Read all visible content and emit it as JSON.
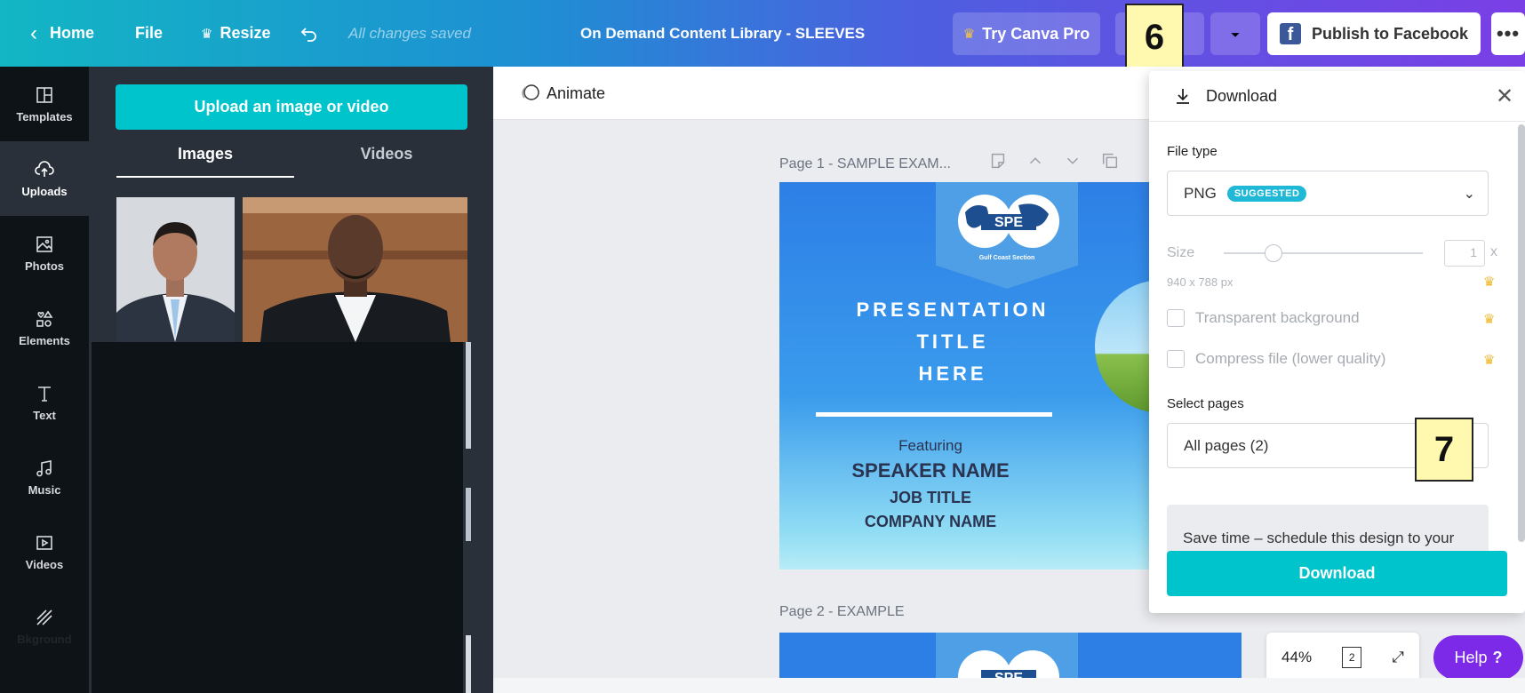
{
  "topbar": {
    "home": "Home",
    "file": "File",
    "resize": "Resize",
    "saved_status": "All changes saved",
    "doc_title": "On Demand Content Library - SLEEVES",
    "try_pro": "Try Canva Pro",
    "publish": "Publish to Facebook",
    "more": "•••"
  },
  "badges": {
    "six": "6",
    "seven": "7"
  },
  "rail": [
    {
      "label": "Templates",
      "icon": "templates-icon"
    },
    {
      "label": "Uploads",
      "icon": "uploads-icon"
    },
    {
      "label": "Photos",
      "icon": "photos-icon"
    },
    {
      "label": "Elements",
      "icon": "elements-icon"
    },
    {
      "label": "Text",
      "icon": "text-icon"
    },
    {
      "label": "Music",
      "icon": "music-icon"
    },
    {
      "label": "Videos",
      "icon": "videos-icon"
    },
    {
      "label": "Bkground",
      "icon": "background-icon"
    }
  ],
  "panel": {
    "upload_button": "Upload an image or video",
    "tabs": [
      "Images",
      "Videos"
    ]
  },
  "canvas": {
    "animate": "Animate",
    "page1_label": "Page 1 - SAMPLE EXAM...",
    "page2_label": "Page 2 - EXAMPLE",
    "zoom": "44%",
    "page_count": "2",
    "help": "Help",
    "help_mark": "?"
  },
  "slide": {
    "logo_text": "SPE",
    "logo_sub": "Gulf Coast Section",
    "title_line1": "PRESENTATION",
    "title_line2": "TITLE",
    "title_line3": "HERE",
    "featuring": "Featuring",
    "speaker": "SPEAKER NAME",
    "job": "JOB TITLE",
    "company": "COMPANY NAME"
  },
  "download": {
    "title": "Download",
    "file_type_label": "File type",
    "file_type_value": "PNG",
    "suggested": "SUGGESTED",
    "size_label": "Size",
    "size_value": "1",
    "size_x": "x",
    "dimensions": "940 x 788 px",
    "transparent": "Transparent background",
    "compress": "Compress file (lower quality)",
    "select_pages_label": "Select pages",
    "select_pages_value": "All pages (2)",
    "promo": "Save time – schedule this design to your",
    "button": "Download"
  },
  "colors": {
    "accent": "#00c4cc",
    "rail_bg": "#0e1318",
    "panel_bg": "#293039",
    "help_bg": "#7d2ae8",
    "facebook": "#3b5998",
    "badge_bg": "#fff9b0"
  }
}
